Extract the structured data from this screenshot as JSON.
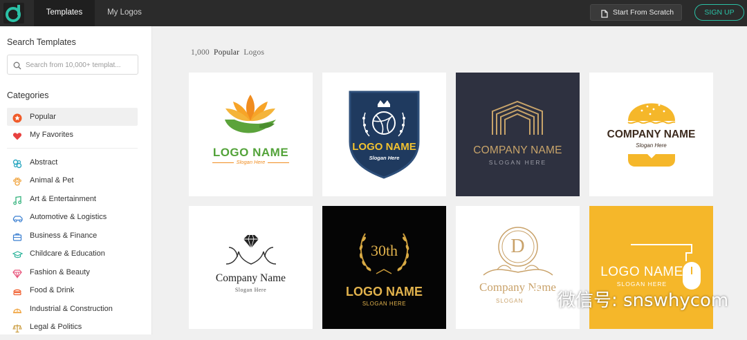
{
  "nav": {
    "tabs": [
      {
        "label": "Templates"
      },
      {
        "label": "My Logos"
      }
    ],
    "start_label": "Start From Scratch",
    "signup_label": "SIGN UP"
  },
  "sidebar": {
    "search_heading": "Search Templates",
    "search_placeholder": "Search from 10,000+ templat...",
    "categories_heading": "Categories",
    "categories": [
      {
        "label": "Popular",
        "icon": "star-badge-icon",
        "color": "#f05a28"
      },
      {
        "label": "My Favorites",
        "icon": "heart-icon",
        "color": "#e8413f"
      },
      {
        "label": "Abstract",
        "icon": "abstract-icon",
        "color": "#2aa7c0"
      },
      {
        "label": "Animal & Pet",
        "icon": "paw-icon",
        "color": "#f0a23a"
      },
      {
        "label": "Art & Entertainment",
        "icon": "music-note-icon",
        "color": "#36b37e"
      },
      {
        "label": "Automotive & Logistics",
        "icon": "car-icon",
        "color": "#3b7fd1"
      },
      {
        "label": "Business & Finance",
        "icon": "briefcase-icon",
        "color": "#3b7fd1"
      },
      {
        "label": "Childcare & Education",
        "icon": "graduation-cap-icon",
        "color": "#2bb39a"
      },
      {
        "label": "Fashion & Beauty",
        "icon": "diamond-icon",
        "color": "#e8537a"
      },
      {
        "label": "Food & Drink",
        "icon": "food-icon",
        "color": "#f05a28"
      },
      {
        "label": "Industrial & Construction",
        "icon": "helmet-icon",
        "color": "#f0a23a"
      },
      {
        "label": "Legal & Politics",
        "icon": "scales-icon",
        "color": "#c99a3a"
      }
    ]
  },
  "content": {
    "count": "1,000",
    "popular": "Popular",
    "logos": "Logos"
  },
  "cards": [
    {
      "line1": "LOGO NAME",
      "line2": "Slogan Here",
      "bg": "#ffffff"
    },
    {
      "line1": "LOGO NAME",
      "line2": "Slogan Here",
      "bg": "#ffffff"
    },
    {
      "line1": "COMPANY NAME",
      "line2": "SLOGAN HERE",
      "bg": "#2e3140"
    },
    {
      "line1": "COMPANY NAME",
      "line2": "Slogan Here",
      "bg": "#ffffff"
    },
    {
      "line1": "Company Name",
      "line2": "Slogan Here",
      "bg": "#ffffff"
    },
    {
      "line1": "LOGO NAME",
      "line2": "SLOGAN HERE",
      "badge": "30th",
      "bg": "#050505"
    },
    {
      "line1": "Company Name",
      "line2": "SLOGAN",
      "initial": "D",
      "bg": "#ffffff"
    },
    {
      "line1": "LOGO NAME",
      "line2": "SLOGAN HERE",
      "bg": "#f5b72a"
    }
  ],
  "watermark": {
    "text": "微信号: snswhycom"
  },
  "colors": {
    "accent": "#2bc1a6",
    "topbar": "#2b2b2b"
  }
}
